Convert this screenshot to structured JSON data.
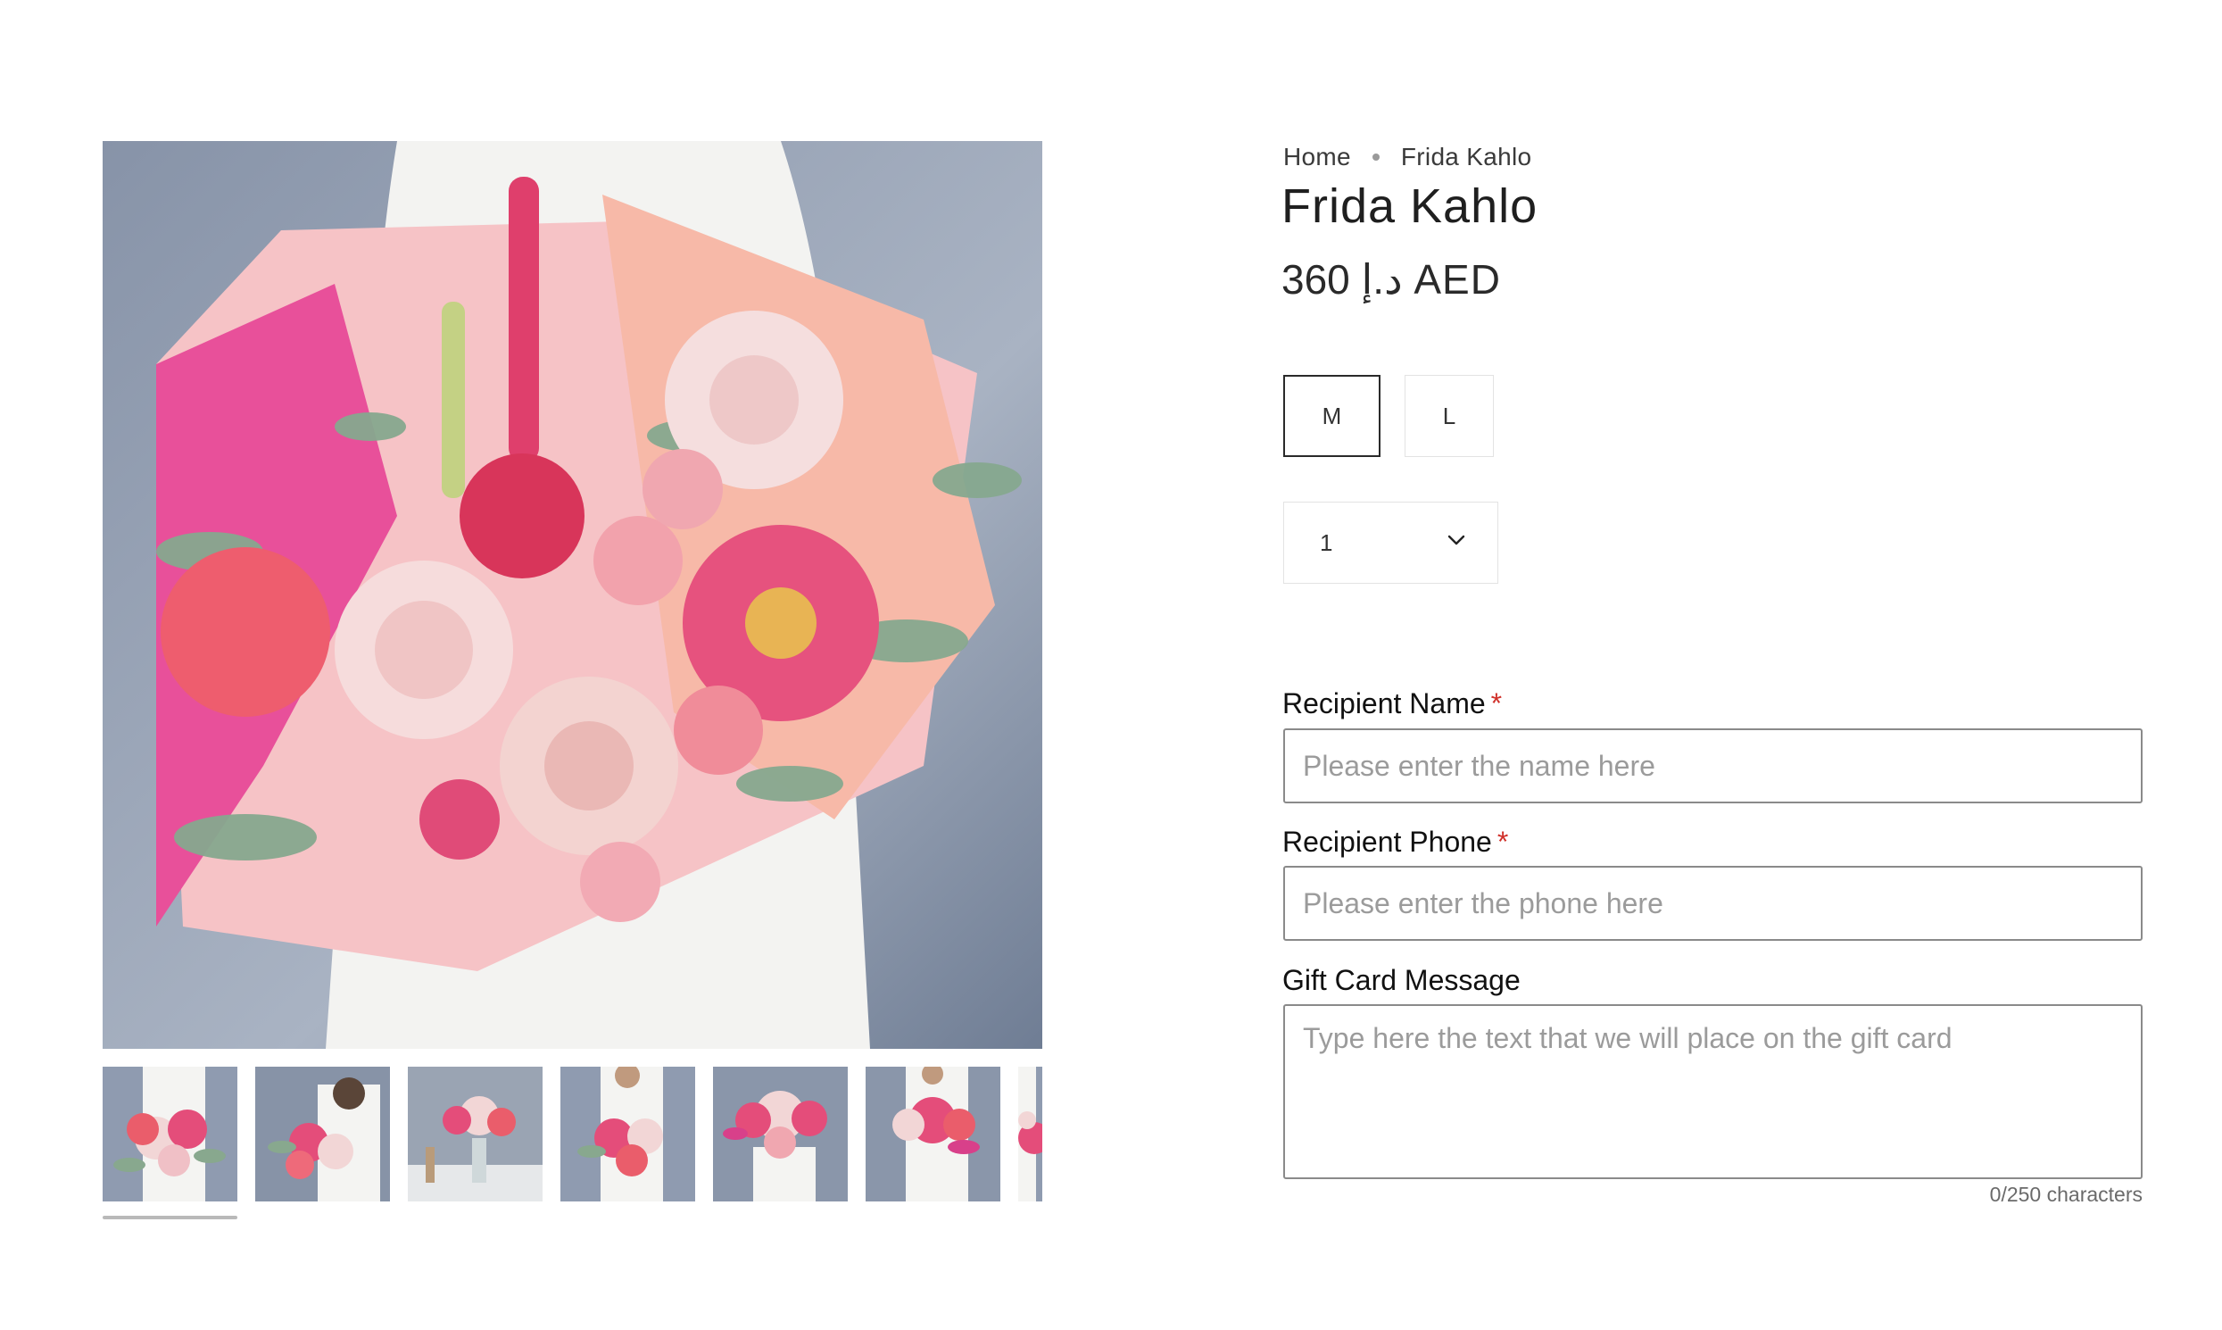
{
  "breadcrumb": {
    "home": "Home",
    "current": "Frida Kahlo"
  },
  "product": {
    "title": "Frida Kahlo",
    "price": "360 د.إ AED"
  },
  "variants": {
    "selected": "M",
    "options": [
      "M",
      "L"
    ]
  },
  "quantity": {
    "value": "1"
  },
  "form": {
    "recipient_name": {
      "label": "Recipient Name",
      "required_mark": "*",
      "placeholder": "Please enter the name here",
      "value": ""
    },
    "recipient_phone": {
      "label": "Recipient Phone",
      "required_mark": "*",
      "placeholder": "Please enter the phone here",
      "value": ""
    },
    "gift_message": {
      "label": "Gift Card Message",
      "placeholder": "Type here the text that we will place on the gift card",
      "value": "",
      "char_count": "0/250 characters"
    }
  },
  "gallery": {
    "thumbnail_count": 7,
    "active_thumbnail": 1
  },
  "colors": {
    "required": "#d0302a",
    "input_border": "#8a8a8a",
    "variant_selected_border": "#2a2a2a"
  },
  "icons": {
    "quantity_dropdown": "chevron-down-icon"
  }
}
